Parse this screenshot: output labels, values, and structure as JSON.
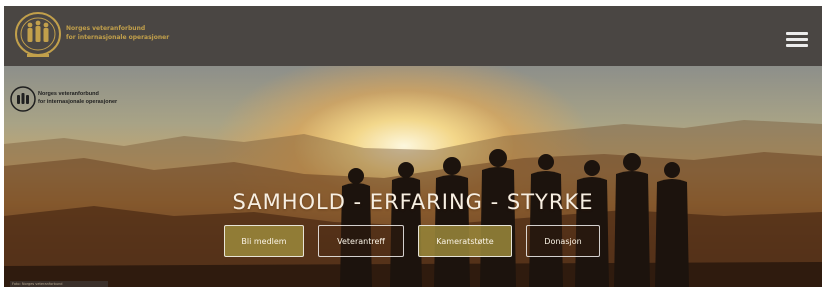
{
  "header": {
    "org_name_line1": "Norges veteranforbund",
    "org_name_line2": "for internasjonale operasjoner",
    "brand_color": "#c2a04b",
    "bar_color": "#4a4643"
  },
  "hero": {
    "logo_line1": "Norges veteranforbund",
    "logo_line2": "for internasjonale operasjoner",
    "tagline": "SAMHOLD - ERFARING - STYRKE",
    "buttons": [
      {
        "label": "Bli medlem",
        "style": "olive"
      },
      {
        "label": "Veterantreff",
        "style": "clear"
      },
      {
        "label": "Kameratstøtte",
        "style": "olive"
      },
      {
        "label": "Donasjon",
        "style": "clear"
      }
    ],
    "photo_credit": "Foto: Norges veteranforbund"
  },
  "icons": {
    "menu": "hamburger-menu-icon",
    "logo": "veteran-emblem-icon"
  }
}
